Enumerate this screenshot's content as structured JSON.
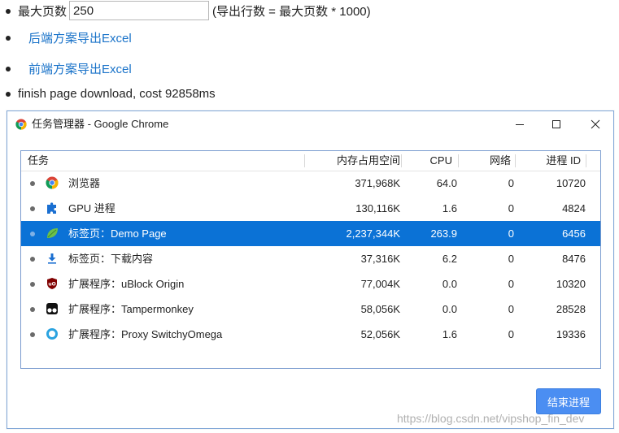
{
  "page": {
    "max_pages_label": "最大页数",
    "max_pages_value": "250",
    "max_pages_hint": "(导出行数 = 最大页数 * 1000)",
    "backend_link": "后端方案导出Excel",
    "frontend_link": "前端方案导出Excel",
    "status_text": "finish page download, cost 92858ms"
  },
  "task_manager": {
    "title": "任务管理器 - Google Chrome",
    "columns": {
      "task": "任务",
      "memory": "内存占用空间",
      "cpu": "CPU",
      "network": "网络",
      "pid": "进程 ID"
    },
    "rows": [
      {
        "name": "浏览器",
        "icon": "chrome-icon",
        "memory": "371,968K",
        "cpu": "64.0",
        "network": "0",
        "pid": "10720",
        "selected": false
      },
      {
        "name": "GPU 进程",
        "icon": "puzzle-icon",
        "memory": "130,116K",
        "cpu": "1.6",
        "network": "0",
        "pid": "4824",
        "selected": false
      },
      {
        "name": "标签页：Demo Page",
        "icon": "leaf-icon",
        "memory": "2,237,344K",
        "cpu": "263.9",
        "network": "0",
        "pid": "6456",
        "selected": true
      },
      {
        "name": "标签页：下载内容",
        "icon": "download-icon",
        "memory": "37,316K",
        "cpu": "6.2",
        "network": "0",
        "pid": "8476",
        "selected": false
      },
      {
        "name": "扩展程序：uBlock Origin",
        "icon": "ublock-icon",
        "memory": "77,004K",
        "cpu": "0.0",
        "network": "0",
        "pid": "10320",
        "selected": false
      },
      {
        "name": "扩展程序：Tampermonkey",
        "icon": "tampermonkey-icon",
        "memory": "58,056K",
        "cpu": "0.0",
        "network": "0",
        "pid": "28528",
        "selected": false
      },
      {
        "name": "扩展程序：Proxy SwitchyOmega",
        "icon": "switchyomega-icon",
        "memory": "52,056K",
        "cpu": "1.6",
        "network": "0",
        "pid": "19336",
        "selected": false
      }
    ],
    "end_process_button": "结束进程"
  },
  "watermark": "https://blog.csdn.net/vipshop_fin_dev",
  "colors": {
    "link": "#1a73c9",
    "selected_row": "#0b72d6",
    "end_button": "#4b8ef2",
    "window_border": "#7fa6d6"
  }
}
